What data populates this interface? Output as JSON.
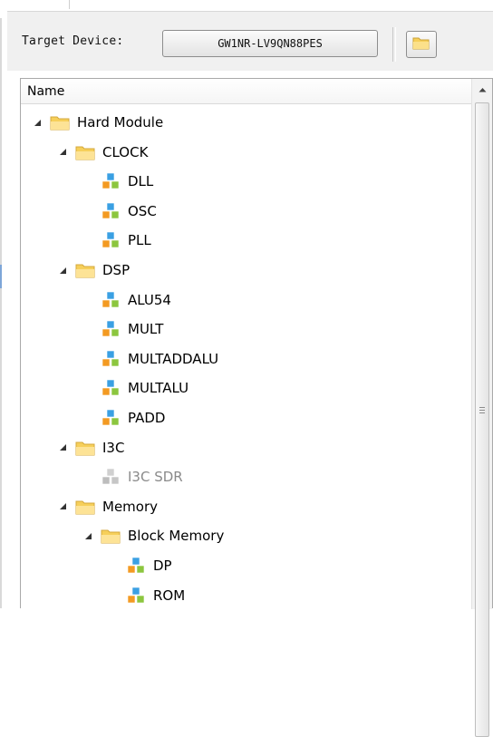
{
  "toolbar": {
    "target_label": "Target Device:",
    "device_value": "GW1NR-LV9QN88PES",
    "browse_icon": "folder-icon"
  },
  "tree": {
    "header": "Name",
    "items": [
      {
        "label": "Hard Module",
        "icon": "folder-icon",
        "expanded": true,
        "level": 0
      },
      {
        "label": "CLOCK",
        "icon": "folder-icon",
        "expanded": true,
        "level": 1
      },
      {
        "label": "DLL",
        "icon": "module-cubes-icon",
        "level": 2
      },
      {
        "label": "OSC",
        "icon": "module-cubes-icon",
        "level": 2
      },
      {
        "label": "PLL",
        "icon": "module-cubes-icon",
        "level": 2
      },
      {
        "label": "DSP",
        "icon": "folder-icon",
        "expanded": true,
        "level": 1
      },
      {
        "label": "ALU54",
        "icon": "module-cubes-icon",
        "level": 2
      },
      {
        "label": "MULT",
        "icon": "module-cubes-icon",
        "level": 2
      },
      {
        "label": "MULTADDALU",
        "icon": "module-cubes-icon",
        "level": 2
      },
      {
        "label": "MULTALU",
        "icon": "module-cubes-icon",
        "level": 2
      },
      {
        "label": "PADD",
        "icon": "module-cubes-icon",
        "level": 2
      },
      {
        "label": "I3C",
        "icon": "folder-icon",
        "expanded": true,
        "level": 1
      },
      {
        "label": "I3C SDR",
        "icon": "module-cubes-disabled-icon",
        "level": 2,
        "disabled": true
      },
      {
        "label": "Memory",
        "icon": "folder-icon",
        "expanded": true,
        "level": 1
      },
      {
        "label": "Block Memory",
        "icon": "folder-icon",
        "expanded": true,
        "level": 2
      },
      {
        "label": "DP",
        "icon": "module-cubes-icon",
        "level": 3
      },
      {
        "label": "ROM",
        "icon": "module-cubes-icon",
        "level": 3
      }
    ]
  },
  "scrollbar": {
    "up_icon": "scroll-up-arrow-icon"
  },
  "colors": {
    "folder": "#f6cf5a",
    "panel_bg": "#f0f0f0",
    "disabled_text": "#8a8a8a"
  }
}
